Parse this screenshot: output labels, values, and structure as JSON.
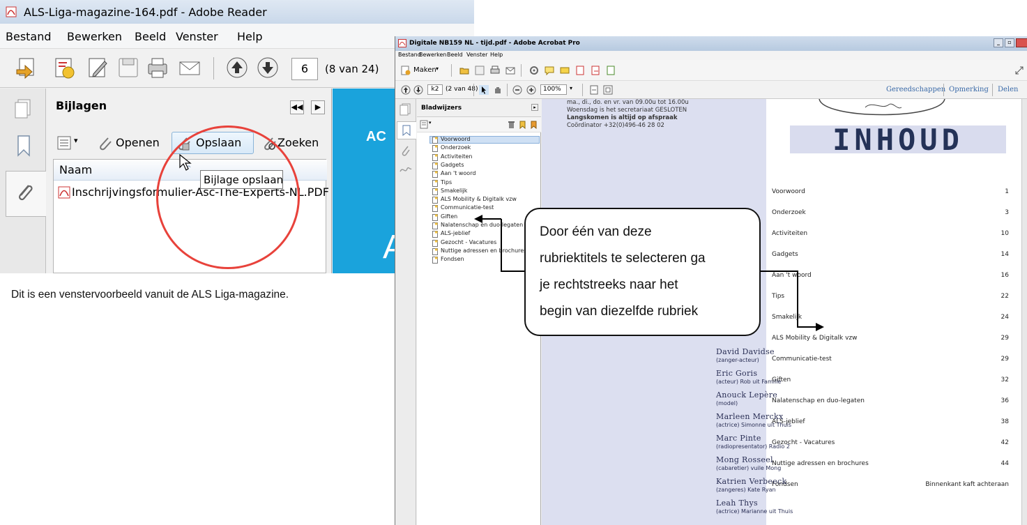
{
  "reader": {
    "title": "ALS-Liga-magazine-164.pdf - Adobe Reader",
    "menu": [
      "Bestand",
      "Bewerken",
      "Beeld",
      "Venster",
      "Help"
    ],
    "page_input": "6",
    "page_of": "(8 van 24)",
    "panel_title": "Bijlagen",
    "tools": {
      "open": "Openen",
      "save": "Opslaan",
      "search": "Zoeken"
    },
    "column": "Naam",
    "file": "Inschrijvingsformulier-Asc-The-Experts-NL.PDF",
    "tooltip": "Bijlage opslaan",
    "blue_text_a": "AC",
    "blue_text_b": "A"
  },
  "caption": "Dit is een venstervoorbeeld vanuit de ALS Liga-magazine.",
  "acrobat": {
    "title": "Digitale NB159 NL - tijd.pdf - Adobe Acrobat Pro",
    "menu": [
      "Bestand",
      "Bewerken",
      "Beeld",
      "Venster",
      "Help"
    ],
    "create": "Maken",
    "page_input": "k2",
    "page_of": "(2 van 48)",
    "zoom": "100%",
    "tabs": [
      "Gereedschappen",
      "Opmerking",
      "Delen"
    ],
    "bookmarks_title": "Bladwijzers",
    "bookmarks": [
      "Voorwoord",
      "Onderzoek",
      "Activiteiten",
      "Gadgets",
      "Aan 't woord",
      "Tips",
      "Smakelijk",
      "ALS Mobility & Digitalk vzw",
      "Communicatie-test",
      "Giften",
      "Nalatenschap en duo-legaten",
      "ALS-jeblief",
      "Gezocht - Vacatures",
      "Nuttige adressen en brochures",
      "Fondsen"
    ]
  },
  "document": {
    "address": [
      "ma., di., do. en vr. van 09.00u tot 16.00u",
      "Woensdag is het secretariaat GESLOTEN",
      "Langskomen is altijd op afspraak",
      "Coördinator +32(0)496-46 28 02"
    ],
    "heading": "INHOUD",
    "toc": [
      {
        "label": "Voorwoord",
        "page": "1"
      },
      {
        "label": "Onderzoek",
        "page": "3"
      },
      {
        "label": "Activiteiten",
        "page": "10"
      },
      {
        "label": "Gadgets",
        "page": "14"
      },
      {
        "label": "Aan 't woord",
        "page": "16"
      },
      {
        "label": "Tips",
        "page": "22"
      },
      {
        "label": "Smakelijk",
        "page": "24"
      },
      {
        "label": "ALS Mobility & Digitalk vzw",
        "page": "29"
      },
      {
        "label": "Communicatie-test",
        "page": "29"
      },
      {
        "label": "Giften",
        "page": "32"
      },
      {
        "label": "Nalatenschap en duo-legaten",
        "page": "36"
      },
      {
        "label": "ALS-jeblief",
        "page": "38"
      },
      {
        "label": "Gezocht - Vacatures",
        "page": "42"
      },
      {
        "label": "Nuttige adressen en brochures",
        "page": "44"
      },
      {
        "label": "Fondsen",
        "page": "Binnenkant kaft achteraan"
      }
    ],
    "people": [
      {
        "name": "David Davidse",
        "role": "(zanger-acteur)"
      },
      {
        "name": "Eric Goris",
        "role": "(acteur) Rob uit Familie"
      },
      {
        "name": "Anouck Lepère",
        "role": "(model)"
      },
      {
        "name": "Marleen Merckx",
        "role": "(actrice) Simonne uit Thuis"
      },
      {
        "name": "Marc Pinte",
        "role": "(radiopresentator) Radio 2"
      },
      {
        "name": "Mong Rosseel",
        "role": "(cabaretier) vuile Mong"
      },
      {
        "name": "Katrien Verbeeck",
        "role": "(zangeres) Kate Ryan"
      },
      {
        "name": "Leah Thys",
        "role": "(actrice) Marianne uit Thuis"
      }
    ]
  },
  "callout": [
    "Door één van deze",
    "rubriektitels te selecteren ga",
    "je rechtstreeks naar het",
    "begin van diezelfde rubriek"
  ]
}
